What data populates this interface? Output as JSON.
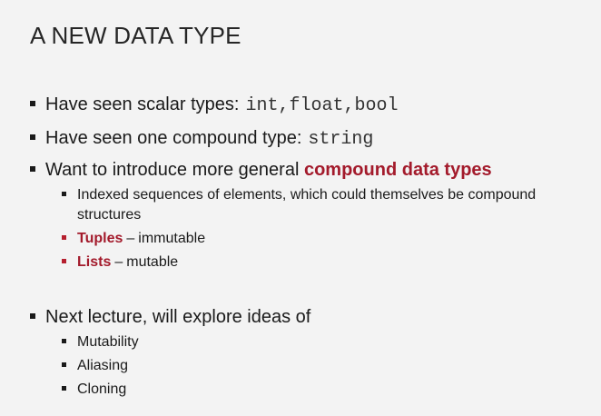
{
  "slide": {
    "title": "A NEW DATA TYPE",
    "bullets": {
      "b1_text": "Have seen scalar types:",
      "b1_code": "int,float,bool",
      "b2_text": "Have seen one compound type:",
      "b2_code": "string",
      "b3_text": "Want to introduce more general ",
      "b3_highlight": "compound data types",
      "b3_sub1_line1": "Indexed sequences of elements, which could themselves be compound",
      "b3_sub1_line2": "structures",
      "b3_sub2_term": "Tuples",
      "b3_sub2_rest": "immutable",
      "b3_sub3_term": "Lists",
      "b3_sub3_rest": "mutable",
      "dash": "–",
      "b4_text": "Next lecture, will explore ideas of",
      "b4_sub1": "Mutability",
      "b4_sub2": "Aliasing",
      "b4_sub3": "Cloning"
    },
    "colors": {
      "accent": "#a31a2b",
      "background": "#f3f3f3",
      "text": "#1a1a1a"
    }
  }
}
